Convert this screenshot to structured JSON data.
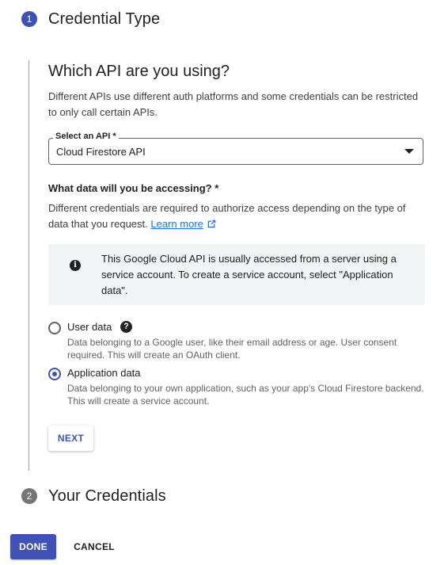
{
  "colors": {
    "accent": "#3f51b5",
    "step_inactive": "#757575",
    "link": "#1a73e8"
  },
  "step1": {
    "number": "1",
    "title": "Credential Type"
  },
  "section": {
    "heading": "Which API are you using?",
    "description_line1": "Different APIs use different auth platforms and some credentials can be restricted",
    "description_line2": "to only call certain APIs."
  },
  "api_select": {
    "label": "Select an API *",
    "value": "Cloud Firestore API"
  },
  "data_question": {
    "label": "What data will you be accessing? *",
    "line1": "Different credentials are required to authorize access depending on the type of",
    "line2_prefix": "data that you request.",
    "learn_more": "Learn more"
  },
  "info": {
    "icon": "info-icon",
    "line1": "This Google Cloud API is usually accessed from a server using a",
    "line2": "service account. To create a service account, select \"Application",
    "line3": "data\"."
  },
  "options": [
    {
      "label": "User data",
      "checked": false,
      "desc_line1": "Data belonging to a Google user, like their email address or age. User consent",
      "desc_line2": "required. This will create an OAuth client."
    },
    {
      "label": "Application data",
      "checked": true,
      "desc_line1": "Data belonging to your own application, such as your app's Cloud Firestore backend.",
      "desc_line2": "This will create a service account."
    }
  ],
  "next_label": "NEXT",
  "step2": {
    "number": "2",
    "title": "Your Credentials"
  },
  "footer": {
    "done_label": "DONE",
    "cancel_label": "CANCEL"
  }
}
